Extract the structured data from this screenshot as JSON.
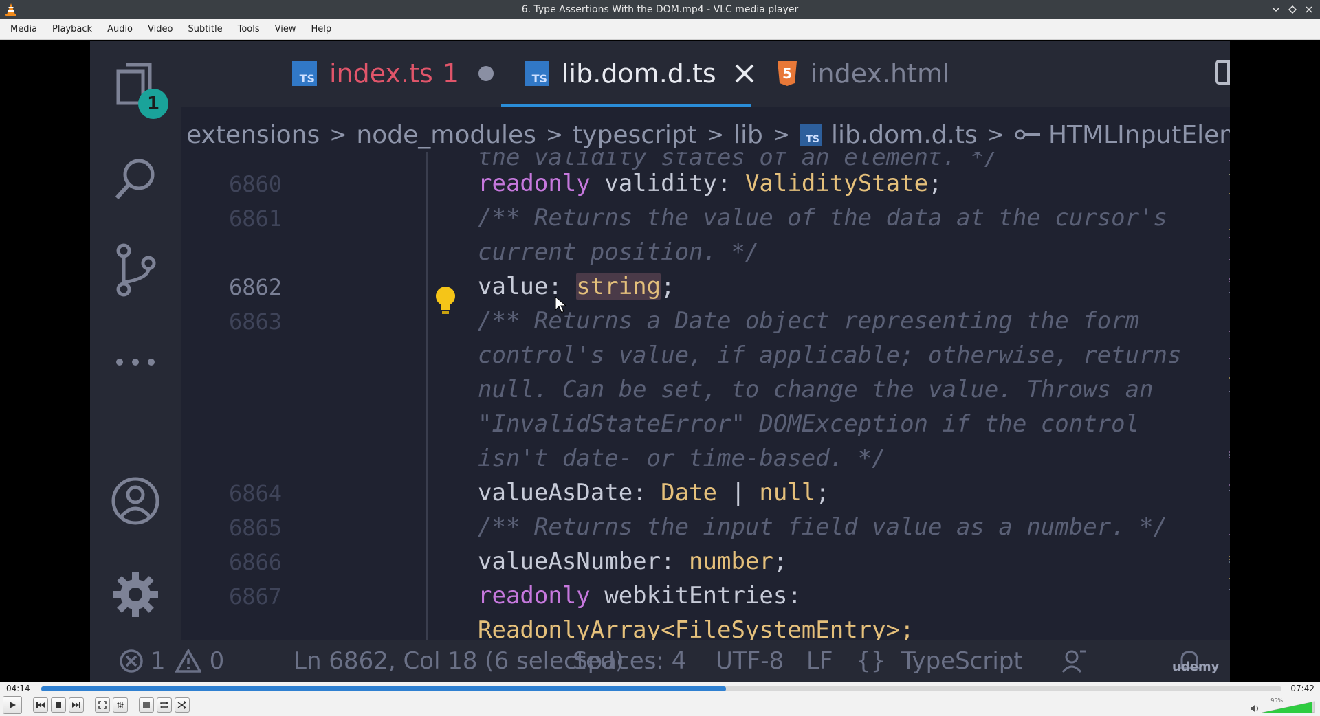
{
  "window": {
    "title": "6. Type Assertions With the DOM.mp4 - VLC media player",
    "controls": [
      "minimize-icon",
      "maximize-icon",
      "close-icon"
    ]
  },
  "menubar": {
    "items": [
      "Media",
      "Playback",
      "Audio",
      "Video",
      "Subtitle",
      "Tools",
      "View",
      "Help"
    ]
  },
  "video_frame": {
    "activity_bar": {
      "explorer_badge": "1",
      "icons": [
        "files-icon",
        "search-icon",
        "source-control-icon",
        "more-icon",
        "account-icon",
        "settings-gear-icon"
      ]
    },
    "tabs": [
      {
        "label": "index.ts",
        "badge": "1",
        "icon": "ts-file-icon",
        "state": "modified"
      },
      {
        "label": "lib.dom.d.ts",
        "icon": "ts-file-icon",
        "state": "active"
      },
      {
        "label": "index.html",
        "icon": "html5-file-icon",
        "state": "inactive"
      }
    ],
    "breadcrumb": [
      "extensions",
      "node_modules",
      "typescript",
      "lib",
      "lib.dom.d.ts",
      "HTMLInputElement"
    ],
    "code": {
      "line_top": "the validity states of an element. */",
      "l6860_num": "6860",
      "l6860_kw": "readonly",
      "l6860_name": " validity: ",
      "l6860_type": "ValidityState",
      "l6860_end": ";",
      "l6861_num": "6861",
      "l6861_a": "/** Returns the value of the data at the cursor's",
      "l6861_b": "current position. */",
      "l6862_num": "6862",
      "l6862_name": "value: ",
      "l6862_type": "string",
      "l6862_end": ";",
      "l6863_num": "6863",
      "l6863_a": "/** Returns a Date object representing the form",
      "l6863_b": "control's value, if applicable; otherwise, returns",
      "l6863_c": "null. Can be set, to change the value. Throws an",
      "l6863_d": "\"InvalidStateError\" DOMException if the control",
      "l6863_e": "isn't date- or time-based. */",
      "l6864_num": "6864",
      "l6864_name": "valueAsDate: ",
      "l6864_type1": "Date",
      "l6864_pipe": " | ",
      "l6864_type2": "null",
      "l6864_end": ";",
      "l6865_num": "6865",
      "l6865_cmt": "/** Returns the input field value as a number. */",
      "l6866_num": "6866",
      "l6866_name": "valueAsNumber: ",
      "l6866_type": "number",
      "l6866_end": ";",
      "l6867_num": "6867",
      "l6867_kw": "readonly",
      "l6867_name": " webkitEntries:",
      "line_bottom": "ReadonlyArray<FileSystemEntry>;"
    },
    "status_bar": {
      "errors": "1",
      "warnings": "0",
      "position": "Ln 6862, Col 18 (6 selected)",
      "spaces": "Spaces: 4",
      "encoding": "UTF-8",
      "eol": "LF",
      "language_brace": "{}",
      "language": "TypeScript",
      "watermark": "udemy"
    }
  },
  "playback": {
    "elapsed": "04:14",
    "total": "07:42",
    "progress_fraction": 0.552,
    "volume_label": "95%",
    "volume_fraction": 0.95
  },
  "colors": {
    "accent": "#2f80d1",
    "volume_fill": "#2ecc40"
  }
}
